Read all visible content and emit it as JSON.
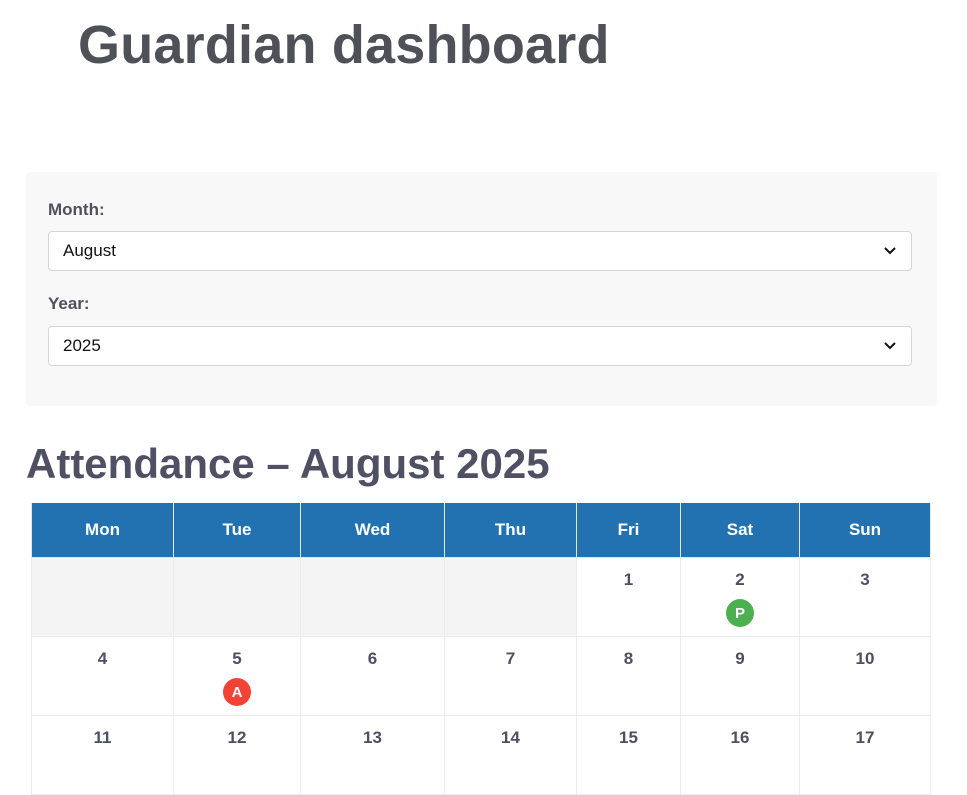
{
  "header": {
    "title": "Guardian dashboard"
  },
  "filters": {
    "month_label": "Month:",
    "month_value": "August",
    "year_label": "Year:",
    "year_value": "2025"
  },
  "attendance": {
    "title": "Attendance – August 2025",
    "weekdays": [
      "Mon",
      "Tue",
      "Wed",
      "Thu",
      "Fri",
      "Sat",
      "Sun"
    ],
    "weeks": [
      [
        null,
        null,
        null,
        null,
        {
          "day": "1"
        },
        {
          "day": "2",
          "status": "P"
        },
        {
          "day": "3"
        }
      ],
      [
        {
          "day": "4"
        },
        {
          "day": "5",
          "status": "A"
        },
        {
          "day": "6"
        },
        {
          "day": "7"
        },
        {
          "day": "8"
        },
        {
          "day": "9"
        },
        {
          "day": "10"
        }
      ],
      [
        {
          "day": "11"
        },
        {
          "day": "12"
        },
        {
          "day": "13"
        },
        {
          "day": "14"
        },
        {
          "day": "15"
        },
        {
          "day": "16"
        },
        {
          "day": "17"
        }
      ]
    ],
    "status_colors": {
      "P": "#4caf50",
      "A": "#f44336"
    },
    "header_color": "#2272b1"
  },
  "icons": {
    "select_arrow": "chevron-down-icon"
  }
}
